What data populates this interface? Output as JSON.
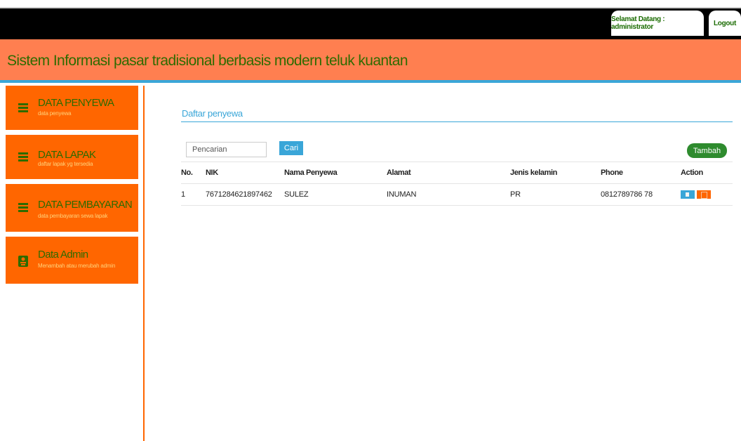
{
  "topbar": {
    "welcome_text": "Selamat Datang : administrator",
    "logout_label": "Logout"
  },
  "header": {
    "title": "Sistem Informasi pasar tradisional berbasis modern teluk kuantan"
  },
  "sidebar": {
    "items": [
      {
        "label": "DATA PENYEWA",
        "sub": "data penyewa",
        "icon": "list-icon"
      },
      {
        "label": "DATA LAPAK",
        "sub": "daftar lapak yg tersedia",
        "icon": "list-icon"
      },
      {
        "label": "DATA PEMBAYARAN",
        "sub": "data pembayaran sewa lapak",
        "icon": "list-icon"
      },
      {
        "label": "Data Admin",
        "sub": "Menambah atau merubah admin",
        "icon": "admin-badge-icon"
      }
    ]
  },
  "main": {
    "page_title": "Daftar penyewa",
    "search": {
      "placeholder": "Pencarian",
      "value": ""
    },
    "search_button": "Cari",
    "add_button": "Tambah",
    "table": {
      "headers": [
        "No.",
        "NIK",
        "Nama Penyewa",
        "Alamat",
        "Jenis kelamin",
        "Phone",
        "Action"
      ],
      "rows": [
        {
          "no": "1",
          "nik": "7671284621897462",
          "nama": "SULEZ",
          "alamat": "INUMAN",
          "jk": "PR",
          "phone": "0812789786 78",
          "edit": "edit-icon",
          "delete": "delete-icon"
        }
      ]
    }
  },
  "colors": {
    "accent_orange": "#ff6600",
    "header_orange": "#ff7f50",
    "text_green": "#2e6b00",
    "link_blue": "#3aa6d8",
    "button_green": "#2e8b2e"
  }
}
